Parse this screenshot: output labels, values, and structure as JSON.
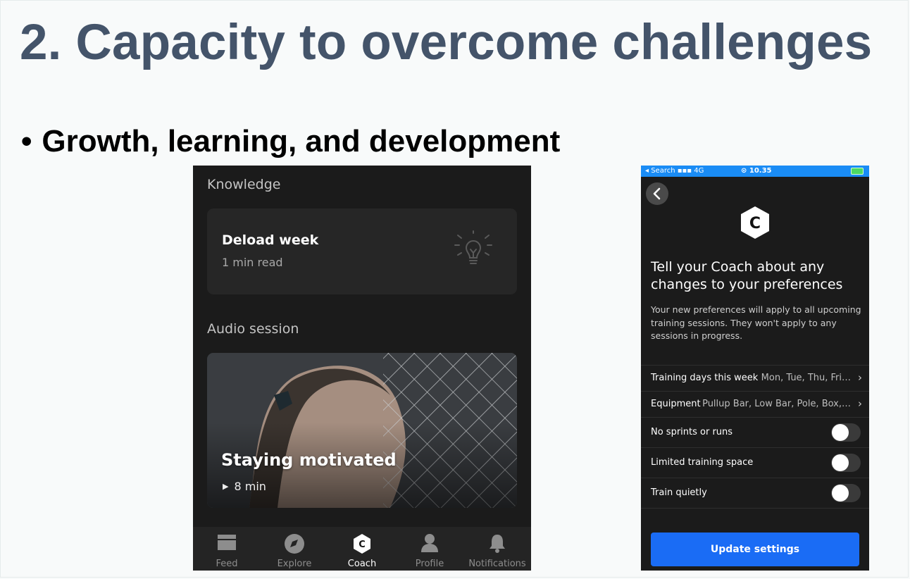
{
  "slide": {
    "title": "2. Capacity to overcome challenges",
    "bullet_mark": "•",
    "bullet": "Growth, learning, and development"
  },
  "left_phone": {
    "knowledge_heading": "Knowledge",
    "knowledge_card": {
      "title": "Deload week",
      "subtitle": "1 min read",
      "icon": "lightbulb-icon"
    },
    "audio_heading": "Audio session",
    "audio_card": {
      "title": "Staying motivated",
      "play_glyph": "▶",
      "duration": "8 min"
    },
    "tabs": [
      {
        "label": "Feed",
        "icon": "feed-icon"
      },
      {
        "label": "Explore",
        "icon": "compass-icon"
      },
      {
        "label": "Coach",
        "icon": "coach-icon",
        "active": true
      },
      {
        "label": "Profile",
        "icon": "profile-icon"
      },
      {
        "label": "Notifications",
        "icon": "bell-icon"
      }
    ]
  },
  "right_phone": {
    "status": {
      "left": "◂ Search ▪▪▪ 4G",
      "time": "⊙ 10.35"
    },
    "coach_letter": "C",
    "heading": "Tell your Coach about any changes to your preferences",
    "description": "Your new preferences will apply to all upcoming training sessions. They won't apply to any sessions in progress.",
    "rows": [
      {
        "label": "Training days this week",
        "value": "Mon, Tue, Thu, Fri…"
      },
      {
        "label": "Equipment",
        "value": "Pullup Bar, Low Bar, Pole, Box,…"
      }
    ],
    "toggles": [
      {
        "label": "No sprints or runs",
        "on": false
      },
      {
        "label": "Limited training space",
        "on": false
      },
      {
        "label": "Train quietly",
        "on": false
      }
    ],
    "chevron": "›",
    "update_button": "Update settings"
  },
  "colors": {
    "title": "#44546a",
    "phone_bg": "#1b1b1b",
    "status_bar": "#1a8cf5",
    "button": "#1a6cf5"
  }
}
